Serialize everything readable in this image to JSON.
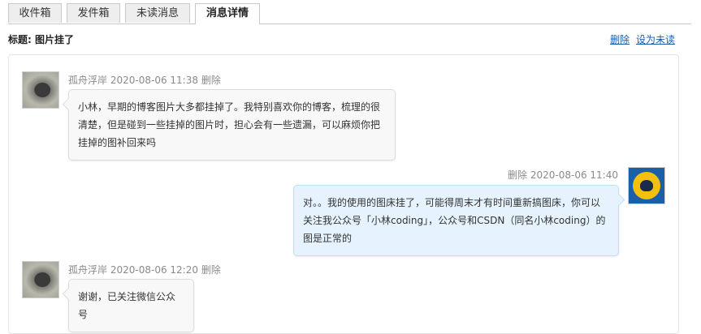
{
  "tabs": [
    {
      "label": "收件箱"
    },
    {
      "label": "发件箱"
    },
    {
      "label": "未读消息"
    },
    {
      "label": "消息详情",
      "active": true
    }
  ],
  "subject": {
    "prefix": "标题:",
    "title": "图片挂了"
  },
  "actions": {
    "delete": "删除",
    "mark_unread": "设为未读"
  },
  "messages": [
    {
      "side": "left",
      "author": "孤舟浮岸",
      "time": "2020-08-06 11:38",
      "delete": "删除",
      "text": "小林，早期的博客图片大多都挂掉了。我特别喜欢你的博客，梳理的很清楚，但是碰到一些挂掉的图片时，担心会有一些遗漏，可以麻烦你把挂掉的图补回来吗"
    },
    {
      "side": "right",
      "time": "2020-08-06 11:40",
      "delete": "删除",
      "text": "对。。我的使用的图床挂了，可能得周末才有时间重新搞图床，你可以关注我公众号「小林coding」，公众号和CSDN（同名小林coding）的图是正常的"
    },
    {
      "side": "left",
      "author": "孤舟浮岸",
      "time": "2020-08-06 12:20",
      "delete": "删除",
      "text": "谢谢，已关注微信公众号"
    }
  ],
  "colors": {
    "link": "#1a5ba8",
    "right_bubble": "#e6f3fe",
    "left_bubble": "#f8f8f8",
    "avatar_blue": "#1b5fa6",
    "avatar_logo": "#f3c00f"
  }
}
